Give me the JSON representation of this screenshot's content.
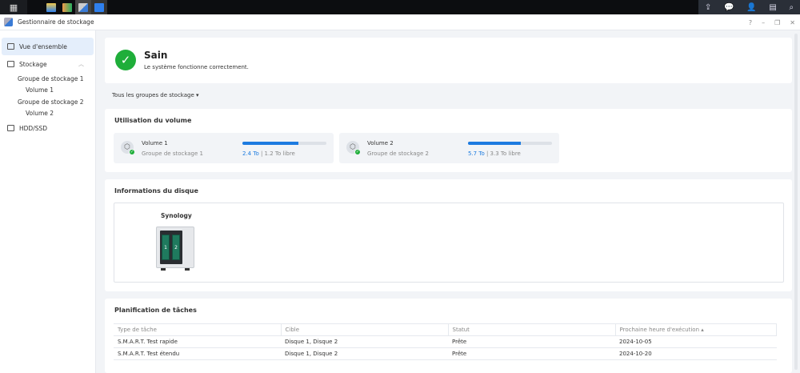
{
  "taskbar": {
    "left_icons": [
      "apps-grid-icon",
      "app-photo-icon",
      "app-download-icon",
      "app-storage-icon",
      "app-panel-icon"
    ],
    "right_icons": [
      "upload-icon",
      "chat-icon",
      "user-icon",
      "widgets-icon",
      "search-icon"
    ]
  },
  "window": {
    "title": "Gestionnaire de stockage",
    "controls": {
      "help": "?",
      "minimize": "–",
      "restore": "❐",
      "close": "✕"
    }
  },
  "sidebar": {
    "items": [
      {
        "label": "Vue d'ensemble"
      },
      {
        "label": "Stockage"
      },
      {
        "label": "Groupe de stockage 1"
      },
      {
        "label": "Volume 1"
      },
      {
        "label": "Groupe de stockage 2"
      },
      {
        "label": "Volume 2"
      },
      {
        "label": "HDD/SSD"
      }
    ]
  },
  "health": {
    "title": "Sain",
    "subtitle": "Le système fonctionne correctement."
  },
  "filter": {
    "label": "Tous les groupes de stockage ▾"
  },
  "volume_usage": {
    "title": "Utilisation du volume",
    "volumes": [
      {
        "name": "Volume 1",
        "group": "Groupe de stockage 1",
        "used": "2.4 To",
        "sep": " | ",
        "free": "1.2 To libre",
        "used_fraction": 0.67
      },
      {
        "name": "Volume 2",
        "group": "Groupe de stockage 2",
        "used": "5.7 To",
        "sep": " | ",
        "free": "3.3 To libre",
        "used_fraction": 0.63
      }
    ]
  },
  "disk_info": {
    "title": "Informations du disque",
    "device": "Synology",
    "bays": [
      "1",
      "2"
    ]
  },
  "tasks": {
    "title": "Planification de tâches",
    "columns": [
      "Type de tâche",
      "Cible",
      "Statut",
      "Prochaine heure d'exécution ▴"
    ],
    "rows": [
      [
        "S.M.A.R.T. Test rapide",
        "Disque 1, Disque 2",
        "Prête",
        "2024-10-05"
      ],
      [
        "S.M.A.R.T. Test étendu",
        "Disque 1, Disque 2",
        "Prête",
        "2024-10-20"
      ]
    ]
  },
  "colors": {
    "accent": "#1d7be0",
    "success": "#1fae3a"
  }
}
